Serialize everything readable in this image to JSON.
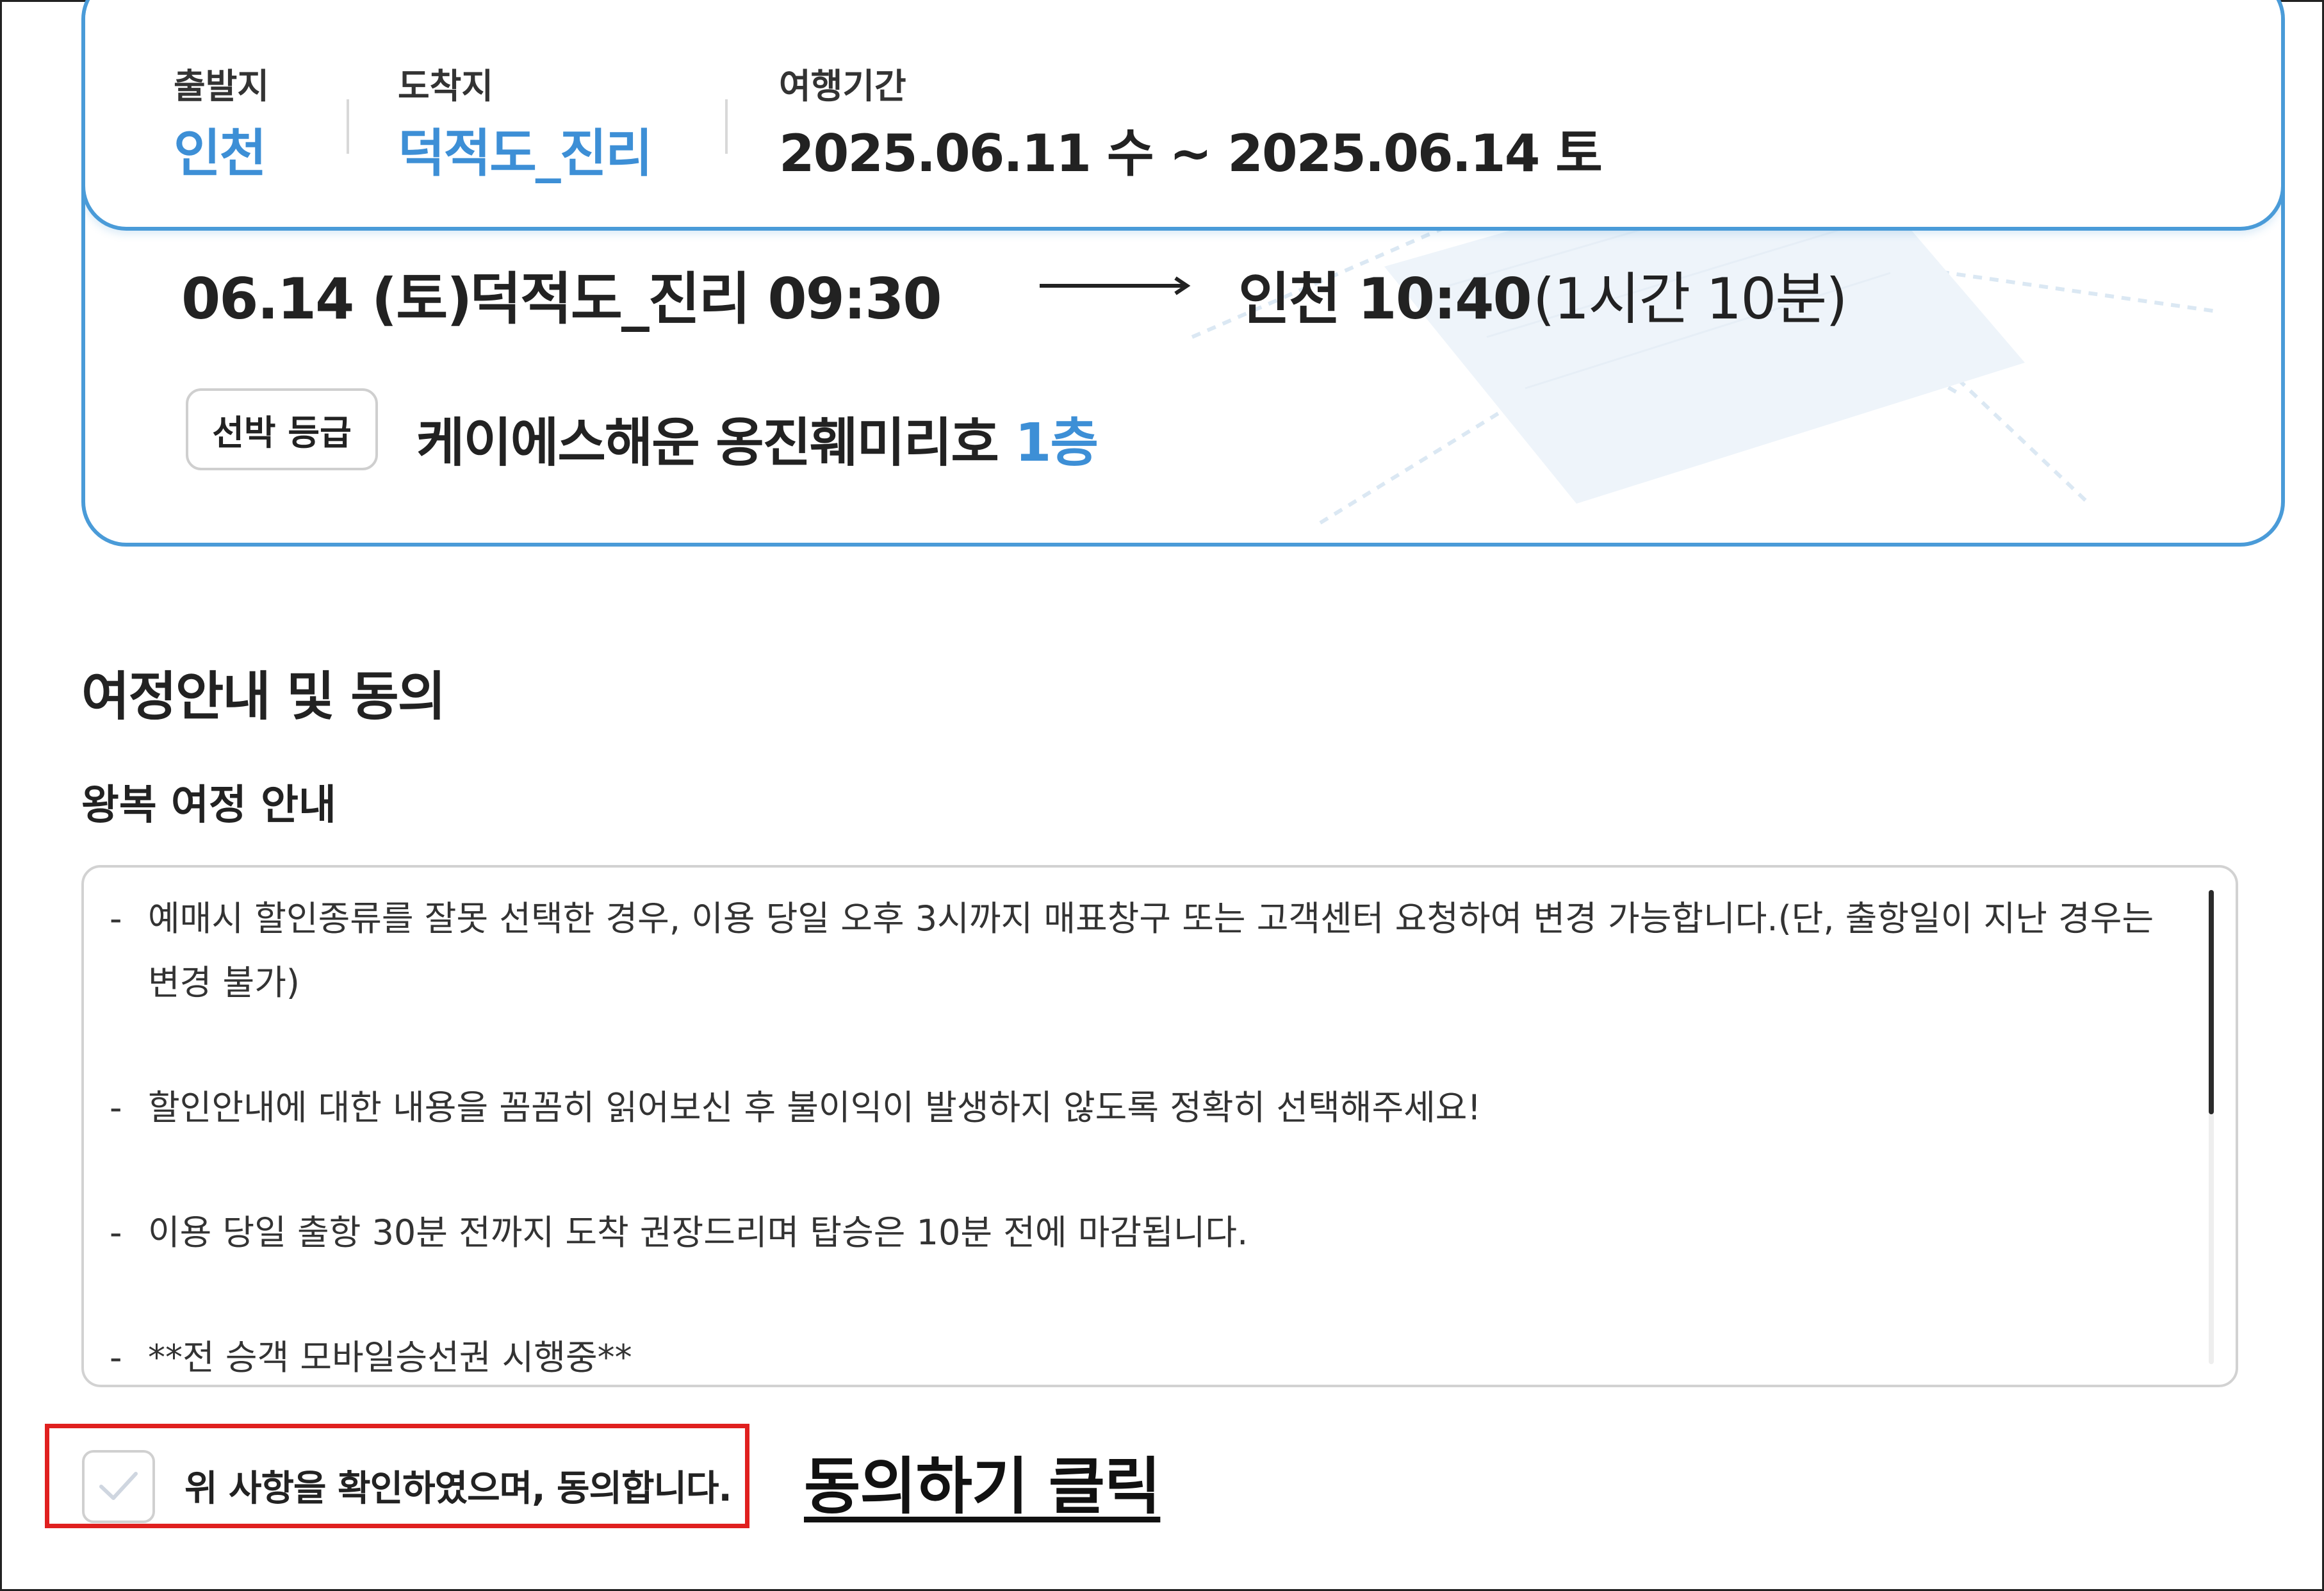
{
  "trip": {
    "departure_label": "출발지",
    "departure_value": "인천",
    "arrival_label": "도착지",
    "arrival_value": "덕적도_진리",
    "period_label": "여행기간",
    "period_value": "2025.06.11 수 ~ 2025.06.14 토"
  },
  "schedule": {
    "date": "06.14 (토)",
    "from": "덕적도_진리 09:30",
    "to": "인천 10:40",
    "duration": "(1시간 10분)"
  },
  "grade": {
    "badge": "선박 등급",
    "ship": "케이에스해운 옹진훼미리호",
    "floor": "1층"
  },
  "section": {
    "title": "여정안내 및 동의",
    "subtitle": "왕복 여정 안내"
  },
  "notices": [
    "예매시 할인종류를 잘못 선택한 경우, 이용 당일 오후 3시까지 매표창구 또는 고객센터 요청하여 변경 가능합니다.(단, 출항일이 지난 경우는 변경 불가)",
    "할인안내에 대한 내용을 꼼꼼히 읽어보신 후 불이익이 발생하지 않도록 정확히 선택해주세요!",
    "이용 당일 출항 30분 전까지 도착 권장드리며 탑승은 10분 전에 마감됩니다.",
    "**전 승객 모바일승선권 시행중**"
  ],
  "notice_bullet": "-",
  "agreement": {
    "label": "위 사항을 확인하였으며, 동의합니다.",
    "checked": false,
    "instruction": "동의하기 클릭"
  },
  "colors": {
    "accent": "#3d8fd6",
    "card_border": "#4a9bd8",
    "highlight": "#e0201f"
  }
}
